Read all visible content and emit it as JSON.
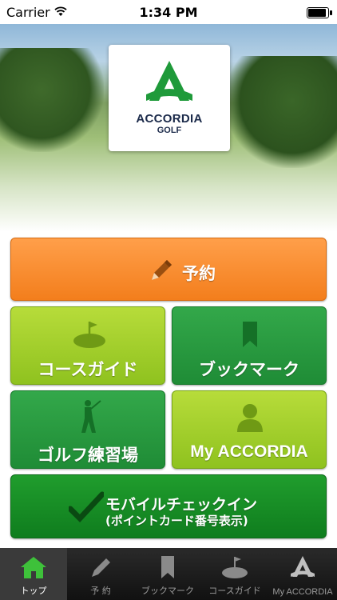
{
  "status_bar": {
    "carrier": "Carrier",
    "time": "1:34 PM"
  },
  "logo": {
    "name": "ACCORDIA",
    "sub": "GOLF"
  },
  "buttons": {
    "reserve": "予約",
    "course_guide": "コースガイド",
    "bookmark": "ブックマーク",
    "practice": "ゴルフ練習場",
    "my_accordia": "My ACCORDIA",
    "checkin_line1": "モバイルチェックイン",
    "checkin_line2": "(ポイントカード番号表示)"
  },
  "tabbar": {
    "tabs": [
      {
        "label": "トップ",
        "icon": "home-icon",
        "active": true
      },
      {
        "label": "予 約",
        "icon": "pencil-icon",
        "active": false
      },
      {
        "label": "ブックマーク",
        "icon": "bookmark-icon",
        "active": false
      },
      {
        "label": "コースガイド",
        "icon": "golf-flag-icon",
        "active": false
      },
      {
        "label": "My ACCORDIA",
        "icon": "accordia-logo-icon",
        "active": false
      }
    ]
  },
  "colors": {
    "orange": "#f37e1c",
    "lime": "#8fc21f",
    "green": "#1f8c36",
    "tab_active": "#3a3a3a"
  }
}
